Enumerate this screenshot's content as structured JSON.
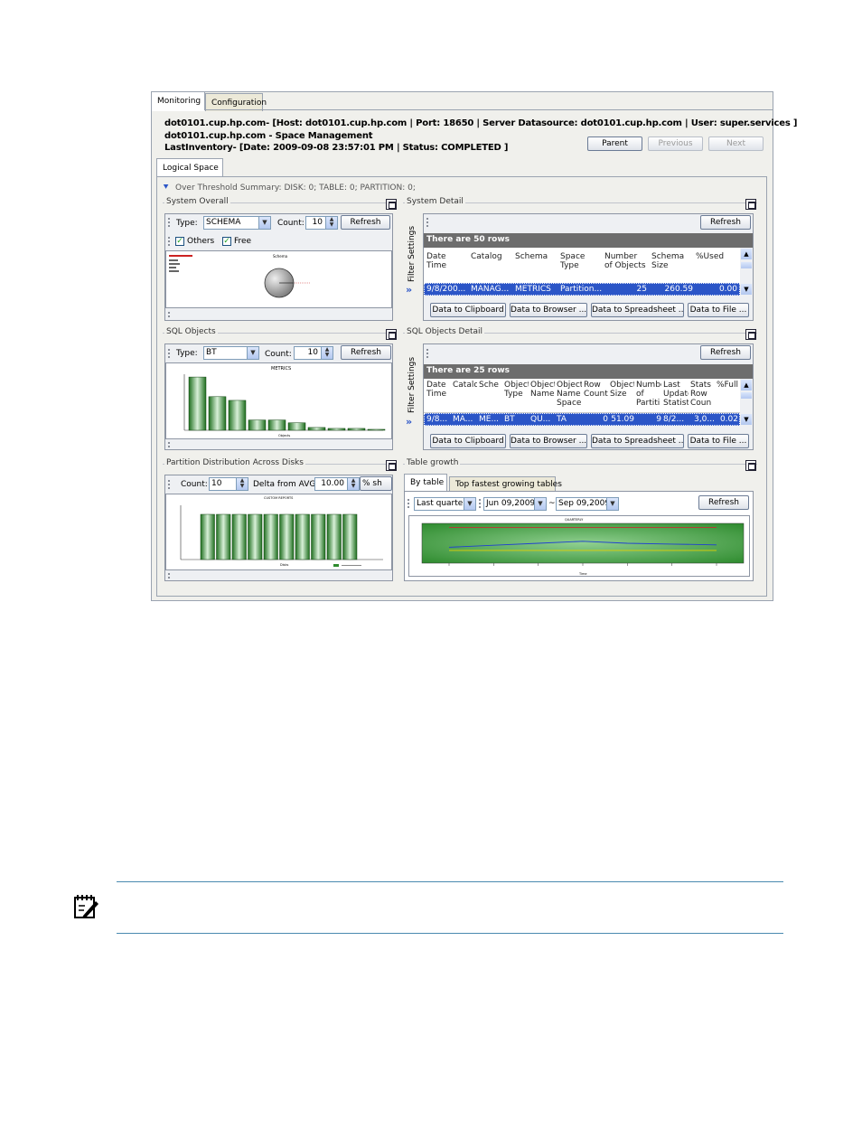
{
  "tabs": {
    "monitoring": "Monitoring",
    "configuration": "Configuration"
  },
  "header": {
    "line1": "dot0101.cup.hp.com- [Host: dot0101.cup.hp.com | Port: 18650 | Server Datasource: dot0101.cup.hp.com | User: super.services ]",
    "line2": "dot0101.cup.hp.com - Space Management",
    "line3": "LastInventory- [Date: 2009-09-08 23:57:01 PM | Status: COMPLETED ]"
  },
  "nav": {
    "parent": "Parent",
    "previous": "Previous",
    "next": "Next"
  },
  "subtab": "Logical Space",
  "threshold": "Over Threshold Summary: DISK: 0; TABLE: 0; PARTITION: 0;",
  "system_overall": {
    "title": "System Overall",
    "type_label": "Type:",
    "type_value": "SCHEMA",
    "count_label": "Count:",
    "count_value": "10",
    "refresh": "Refresh",
    "others": "Others",
    "free": "Free",
    "chart_title": "Schema"
  },
  "system_detail": {
    "title": "System Detail",
    "refresh": "Refresh",
    "filter": "Filter Settings",
    "rows_label": "There are 50 rows",
    "columns": [
      "Date Time",
      "Catalog",
      "Schema",
      "Space Type",
      "Number of Objects",
      "Schema Size",
      "%Used"
    ],
    "row": [
      "9/8/200...",
      "MANAG...",
      "METRICS",
      "Partition...",
      "25",
      "260.59",
      "0.00"
    ],
    "actions": [
      "Data to Clipboard",
      "Data to Browser ...",
      "Data to Spreadsheet ...",
      "Data to File ..."
    ]
  },
  "sql_objects": {
    "title": "SQL Objects",
    "type_label": "Type:",
    "type_value": "BT",
    "count_label": "Count:",
    "count_value": "10",
    "refresh": "Refresh",
    "chart_title": "METRICS",
    "chart_xlabel": "Objects"
  },
  "sql_objects_detail": {
    "title": "SQL Objects Detail",
    "refresh": "Refresh",
    "filter": "Filter Settings",
    "rows_label": "There are 25 rows",
    "columns": [
      "Date Time",
      "Catalo",
      "Sche",
      "Object Type",
      "Object Name",
      "Object Name Space",
      "Row Count",
      "Object Size",
      "Number of Partiti",
      "Last Update Statist",
      "Stats Row Coun",
      "%Full"
    ],
    "row": [
      "9/8...",
      "MA...",
      "ME...",
      "BT",
      "QU...",
      "TA",
      "0",
      "51.09",
      "9",
      "8/2...",
      "3,0...",
      "0.02"
    ],
    "actions": [
      "Data to Clipboard",
      "Data to Browser ...",
      "Data to Spreadsheet ...",
      "Data to File ..."
    ]
  },
  "partition": {
    "title": "Partition Distribution Across Disks",
    "count_label": "Count:",
    "count_value": "10",
    "delta_label": "Delta from AVG:",
    "delta_value": "10.00",
    "unit": "% sh",
    "chart_title": "CUSTOM REPORTS",
    "chart_xlabel": "Disks"
  },
  "table_growth": {
    "title": "Table growth",
    "tab_by_table": "By table",
    "tab_top": "Top fastest growing tables",
    "range": "Last quarter",
    "from": "Jun 09,2009",
    "tilde": "~",
    "to": "Sep 09,2009",
    "refresh": "Refresh",
    "chart_title": "QUARTERLY",
    "chart_xlabel": "Time"
  },
  "chart_data": [
    {
      "type": "pie",
      "title": "Schema",
      "values": [
        100
      ]
    },
    {
      "type": "bar",
      "title": "METRICS",
      "xlabel": "Objects",
      "values": [
        57,
        36,
        32,
        11,
        11,
        8,
        3,
        2,
        2,
        1
      ]
    },
    {
      "type": "bar",
      "title": "CUSTOM REPORTS",
      "xlabel": "Disks",
      "values": [
        10,
        10,
        10,
        10,
        10,
        10,
        10,
        10,
        10,
        10
      ]
    },
    {
      "type": "line",
      "title": "QUARTERLY",
      "xlabel": "Time",
      "x": [
        0,
        1,
        2,
        3,
        4,
        5,
        6
      ],
      "ylim": [
        0,
        10
      ],
      "series": [
        {
          "color": "#c03030",
          "values": [
            9,
            9,
            9,
            9,
            9,
            9,
            9
          ]
        },
        {
          "color": "#2040d0",
          "values": [
            4,
            4.5,
            5,
            5.5,
            5,
            4.8,
            4.6
          ]
        },
        {
          "color": "#e0d000",
          "values": [
            3.2,
            3.2,
            3.2,
            3.2,
            3.2,
            3.2,
            3.2
          ]
        }
      ]
    }
  ],
  "colors": {
    "accent": "#2b55c7",
    "bar": "#2e8b2e",
    "header": "#6d6d6d"
  },
  "icons": {
    "note": "note-icon",
    "expand": "double-chevron-icon",
    "maximize": "maximize-icon"
  }
}
